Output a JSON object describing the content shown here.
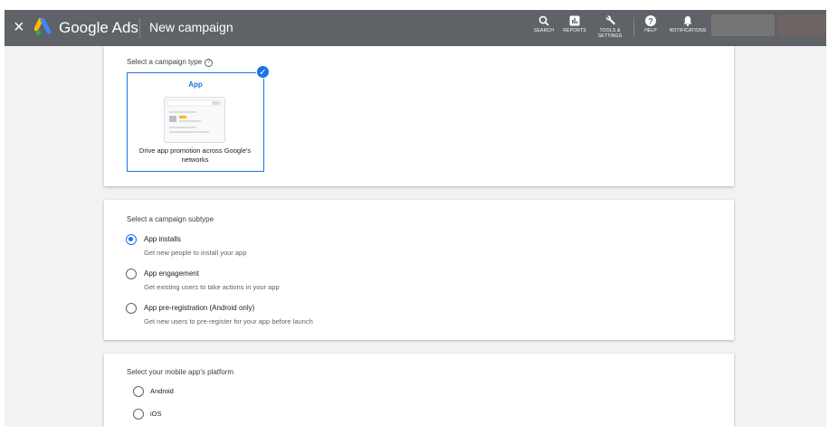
{
  "topbar": {
    "close_glyph": "×",
    "logo_icon": "google-ads-logo",
    "brand": "Google Ads",
    "page_title": "New campaign",
    "tools": [
      {
        "icon": "search-icon",
        "label": "SEARCH"
      },
      {
        "icon": "reports-icon",
        "label": "REPORTS"
      },
      {
        "icon": "wrench-icon",
        "label_line1": "TOOLS &",
        "label_line2": "SETTINGS"
      },
      {
        "icon": "help-icon",
        "label": "HELP"
      },
      {
        "icon": "bell-icon",
        "label": "NOTIFICATIONS"
      }
    ]
  },
  "campaign_type": {
    "heading": "Select a campaign type",
    "help_glyph": "?",
    "tile": {
      "label": "App",
      "description": "Drive app promotion across Google's networks",
      "selected": true,
      "check_glyph": "✓"
    }
  },
  "campaign_subtype": {
    "heading": "Select a campaign subtype",
    "options": [
      {
        "label": "App installs",
        "sub": "Get new people to install your app",
        "selected": true
      },
      {
        "label": "App engagement",
        "sub": "Get existing users to take actions in your app",
        "selected": false
      },
      {
        "label": "App pre-registration (Android only)",
        "sub": "Get new users to pre-register for your app before launch",
        "selected": false
      }
    ]
  },
  "platform": {
    "heading": "Select your mobile app's platform",
    "options": [
      {
        "label": "Android",
        "selected": false
      },
      {
        "label": "iOS",
        "selected": false
      }
    ]
  },
  "colors": {
    "topbar": "#5f6368",
    "accent": "#1a73e8",
    "background": "#f1f3f4"
  }
}
